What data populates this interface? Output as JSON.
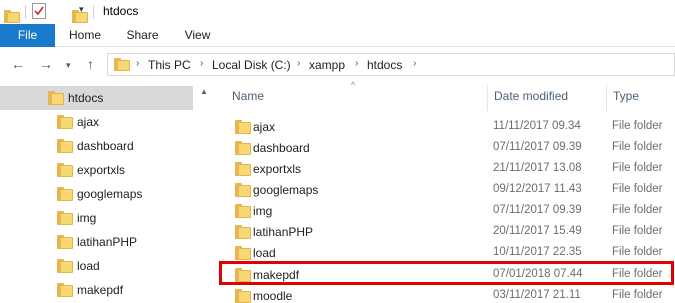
{
  "window": {
    "title": "htdocs"
  },
  "ribbon": {
    "tabs": [
      "File",
      "Home",
      "Share",
      "View"
    ]
  },
  "address": {
    "crumbs": [
      "This PC",
      "Local Disk (C:)",
      "xampp",
      "htdocs"
    ]
  },
  "navpane": {
    "items": [
      {
        "label": "htdocs",
        "selected": true
      },
      {
        "label": "ajax"
      },
      {
        "label": "dashboard"
      },
      {
        "label": "exportxls"
      },
      {
        "label": "googlemaps"
      },
      {
        "label": "img"
      },
      {
        "label": "latihanPHP"
      },
      {
        "label": "load"
      },
      {
        "label": "makepdf"
      }
    ]
  },
  "filelist": {
    "columns": {
      "name": "Name",
      "date": "Date modified",
      "type": "Type"
    },
    "rows": [
      {
        "name": "ajax",
        "date": "11/11/2017 09.34",
        "type": "File folder"
      },
      {
        "name": "dashboard",
        "date": "07/11/2017 09.39",
        "type": "File folder"
      },
      {
        "name": "exportxls",
        "date": "21/11/2017 13.08",
        "type": "File folder"
      },
      {
        "name": "googlemaps",
        "date": "09/12/2017 11.43",
        "type": "File folder"
      },
      {
        "name": "img",
        "date": "07/11/2017 09.39",
        "type": "File folder"
      },
      {
        "name": "latihanPHP",
        "date": "20/11/2017 15.49",
        "type": "File folder"
      },
      {
        "name": "load",
        "date": "10/11/2017 22.35",
        "type": "File folder"
      },
      {
        "name": "makepdf",
        "date": "07/01/2018 07.44",
        "type": "File folder",
        "highlighted": true
      },
      {
        "name": "moodle",
        "date": "03/11/2017 21.11",
        "type": "File folder"
      }
    ]
  },
  "colors": {
    "file_tab": "#1979ca",
    "highlight": "#e00000",
    "folder": "#f8d775",
    "selected": "#d9d9d9"
  },
  "icons": [
    "folder-icon",
    "properties-icon",
    "dropdown-icon",
    "back-icon",
    "forward-icon",
    "recent-icon",
    "up-icon",
    "chevron-right-icon",
    "sort-up-icon"
  ]
}
